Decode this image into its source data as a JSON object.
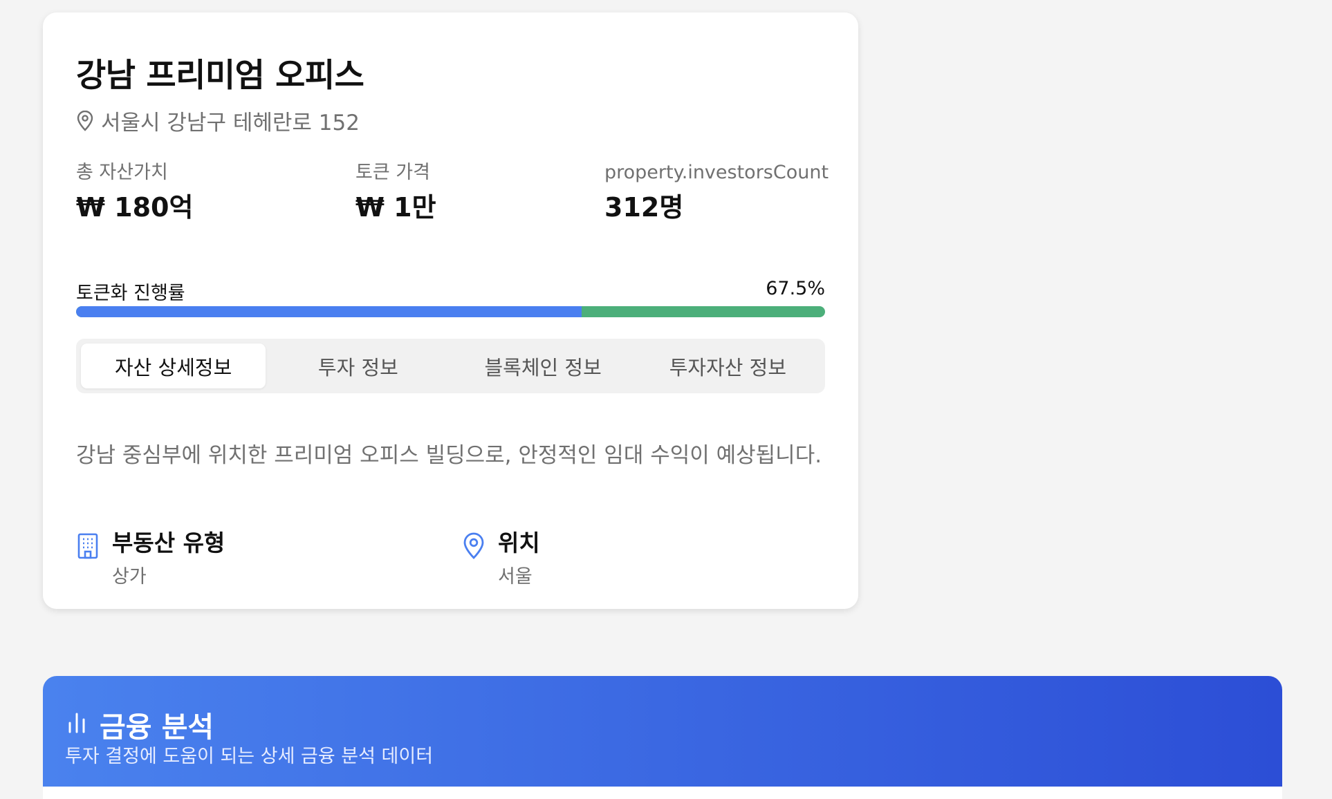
{
  "property": {
    "title": "강남 프리미엄 오피스",
    "address": "서울시 강남구 테헤란로 152",
    "description": "강남 중심부에 위치한 프리미엄 오피스 빌딩으로, 안정적인 임대 수익이 예상됩니다."
  },
  "stats": [
    {
      "label": "총 자산가치",
      "value": "₩ 180억"
    },
    {
      "label": "토큰 가격",
      "value": "₩ 1만"
    },
    {
      "label": "property.investorsCount",
      "value": "312명"
    }
  ],
  "progress": {
    "label": "토큰화 진행률",
    "value_text": "67.5%",
    "fraction": 0.675
  },
  "tabs": [
    {
      "label": "자산 상세정보",
      "active": true
    },
    {
      "label": "투자 정보",
      "active": false
    },
    {
      "label": "블록체인 정보",
      "active": false
    },
    {
      "label": "투자자산 정보",
      "active": false
    }
  ],
  "info": [
    {
      "title": "부동산 유형",
      "value": "상가",
      "icon": "building-icon"
    },
    {
      "title": "위치",
      "value": "서울",
      "icon": "location-pin-icon"
    }
  ],
  "analysis": {
    "title": "금융 분석",
    "subtitle": "투자 결정에 도움이 되는 상세 금융 분석 데이터",
    "icon": "bar-chart-icon"
  },
  "colors": {
    "progress_primary": "#4a7ff0",
    "progress_secondary": "#4caf7a",
    "accent": "#4a82ee",
    "banner_end": "#2c4ed6"
  }
}
